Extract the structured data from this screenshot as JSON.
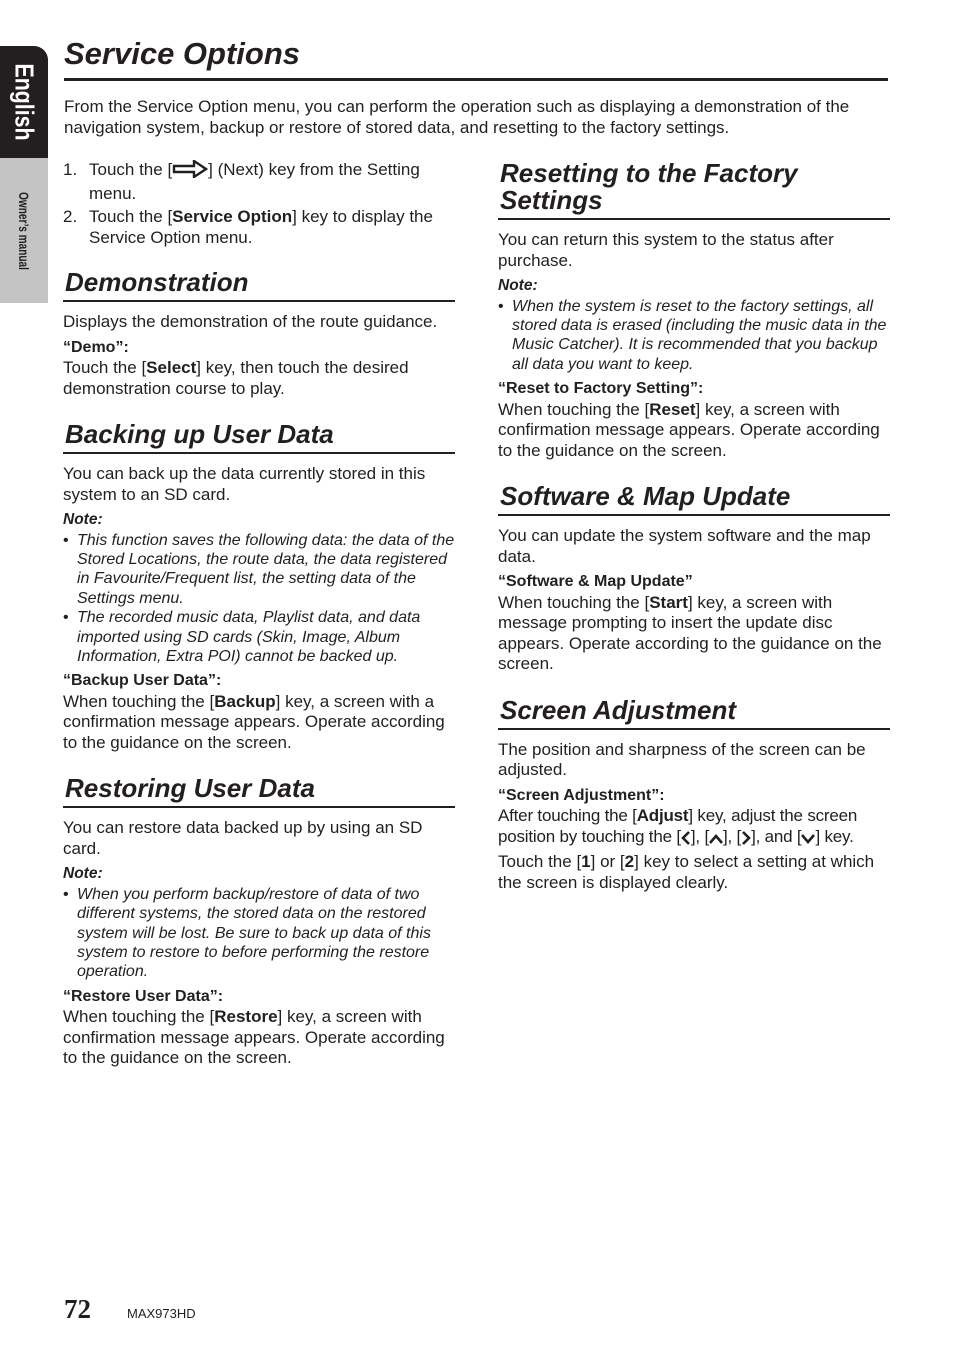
{
  "side_tab": {
    "language": "English",
    "manual": "Owner’s manual"
  },
  "page": {
    "title": "Service Options",
    "intro": "From the Service Option menu, you can perform the operation such as displaying a demonstration of the navigation system, backup or restore of stored data, and resetting to the factory settings.",
    "steps": [
      {
        "num": "1.",
        "before": "Touch the [",
        "icon": "next-arrow-icon",
        "after": "] (Next) key from the Setting menu."
      },
      {
        "num": "2.",
        "before": "Touch the [",
        "key": "Service Option",
        "after": "] key to display the Service Option menu."
      }
    ],
    "sections": {
      "demonstration": {
        "heading": "Demonstration",
        "body": "Displays the demonstration of the route guidance.",
        "label": "“Demo”:",
        "action_before": "Touch the [",
        "action_key": "Select",
        "action_after": "] key, then touch the desired demonstration course to play."
      },
      "backup": {
        "heading": "Backing up User Data",
        "body": "You can back up the data currently stored in this system to an SD card.",
        "note_label": "Note:",
        "notes": [
          "This function saves the following data: the data of the Stored Locations, the route data, the data registered in Favourite/Frequent list, the setting data of the Settings menu.",
          "The recorded music data, Playlist data, and data imported using SD cards (Skin, Image, Album Information, Extra POI) cannot be backed up."
        ],
        "label": "“Backup User Data”:",
        "action_before": "When touching the [",
        "action_key": "Backup",
        "action_after": "] key, a screen with a confirmation message appears. Operate according to the guidance on the screen."
      },
      "restore": {
        "heading": "Restoring User Data",
        "body": "You can restore data backed up by using an SD card.",
        "note_label": "Note:",
        "notes": [
          "When you perform backup/restore of data of two different systems, the stored data on the restored system will be lost. Be sure to back up data of this system to restore to before performing the restore operation."
        ],
        "label": "“Restore User Data”:",
        "action_before": "When touching the [",
        "action_key": "Restore",
        "action_after": "] key, a screen with confirmation message appears. Operate according to the guidance on the screen."
      },
      "reset": {
        "heading": "Resetting to the Factory Settings",
        "body": "You can return this system to the status after purchase.",
        "note_label": "Note:",
        "notes": [
          "When the system is reset to the factory settings, all stored data is erased (including the music data in the Music Catcher). It is recommended that you backup all data you want to keep."
        ],
        "label": "“Reset to Factory Setting”:",
        "action_before": "When touching the [",
        "action_key": "Reset",
        "action_after": "] key, a screen with confirmation message appears. Operate according to the guidance on the screen."
      },
      "update": {
        "heading": "Software & Map Update",
        "body": "You can update the system software and the map data.",
        "label": "“Software & Map Update”",
        "action_before": "When touching the [",
        "action_key": "Start",
        "action_after": "] key, a screen with message prompting to insert the update disc appears. Operate according to the guidance on the screen."
      },
      "screen": {
        "heading": "Screen Adjustment",
        "body": "The position and sharpness of the screen can be adjusted.",
        "label": "“Screen Adjustment”:",
        "a1": "After touching the [",
        "a_key": "Adjust",
        "a2": "] key, adjust the screen position by touching the [",
        "a3": "], [",
        "a4": "], [",
        "a5": "], and [",
        "a6": "] key.",
        "b1": "Touch the [",
        "b_key1": "1",
        "b2": "] or [",
        "b_key2": "2",
        "b3": "] key to select a setting at which the screen is displayed clearly."
      }
    }
  },
  "footer": {
    "page_number": "72",
    "model": "MAX973HD"
  }
}
